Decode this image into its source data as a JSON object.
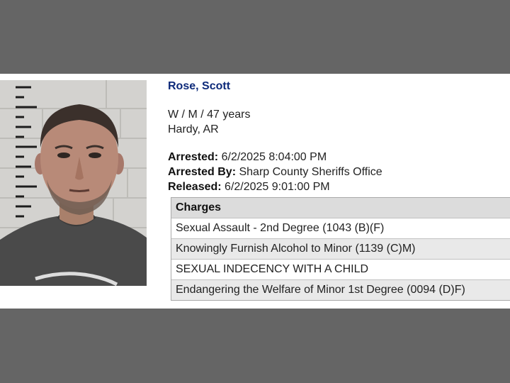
{
  "record": {
    "name": "Rose, Scott",
    "demographics": "W / M / 47 years",
    "location": "Hardy, AR",
    "arrested_label": "Arrested:",
    "arrested_value": "6/2/2025 8:04:00 PM",
    "arrested_by_label": "Arrested By:",
    "arrested_by_value": "Sharp County Sheriffs Office",
    "released_label": "Released:",
    "released_value": "6/2/2025 9:01:00 PM"
  },
  "charges": {
    "header": "Charges",
    "items": [
      "Sexual Assault - 2nd Degree (1043 (B)(F)",
      "Knowingly Furnish Alcohol to Minor (1139 (C)M)",
      "SEXUAL INDECENCY WITH A CHILD",
      "Endangering the Welfare of Minor 1st Degree (0094 (D)F)"
    ]
  },
  "colors": {
    "page_bg": "#656565",
    "name_color": "#0d2a7a",
    "table_header_bg": "#dcdcdc",
    "table_alt_row_bg": "#e9e9e9"
  },
  "mugshot": {
    "icon": "person-photo-icon"
  }
}
